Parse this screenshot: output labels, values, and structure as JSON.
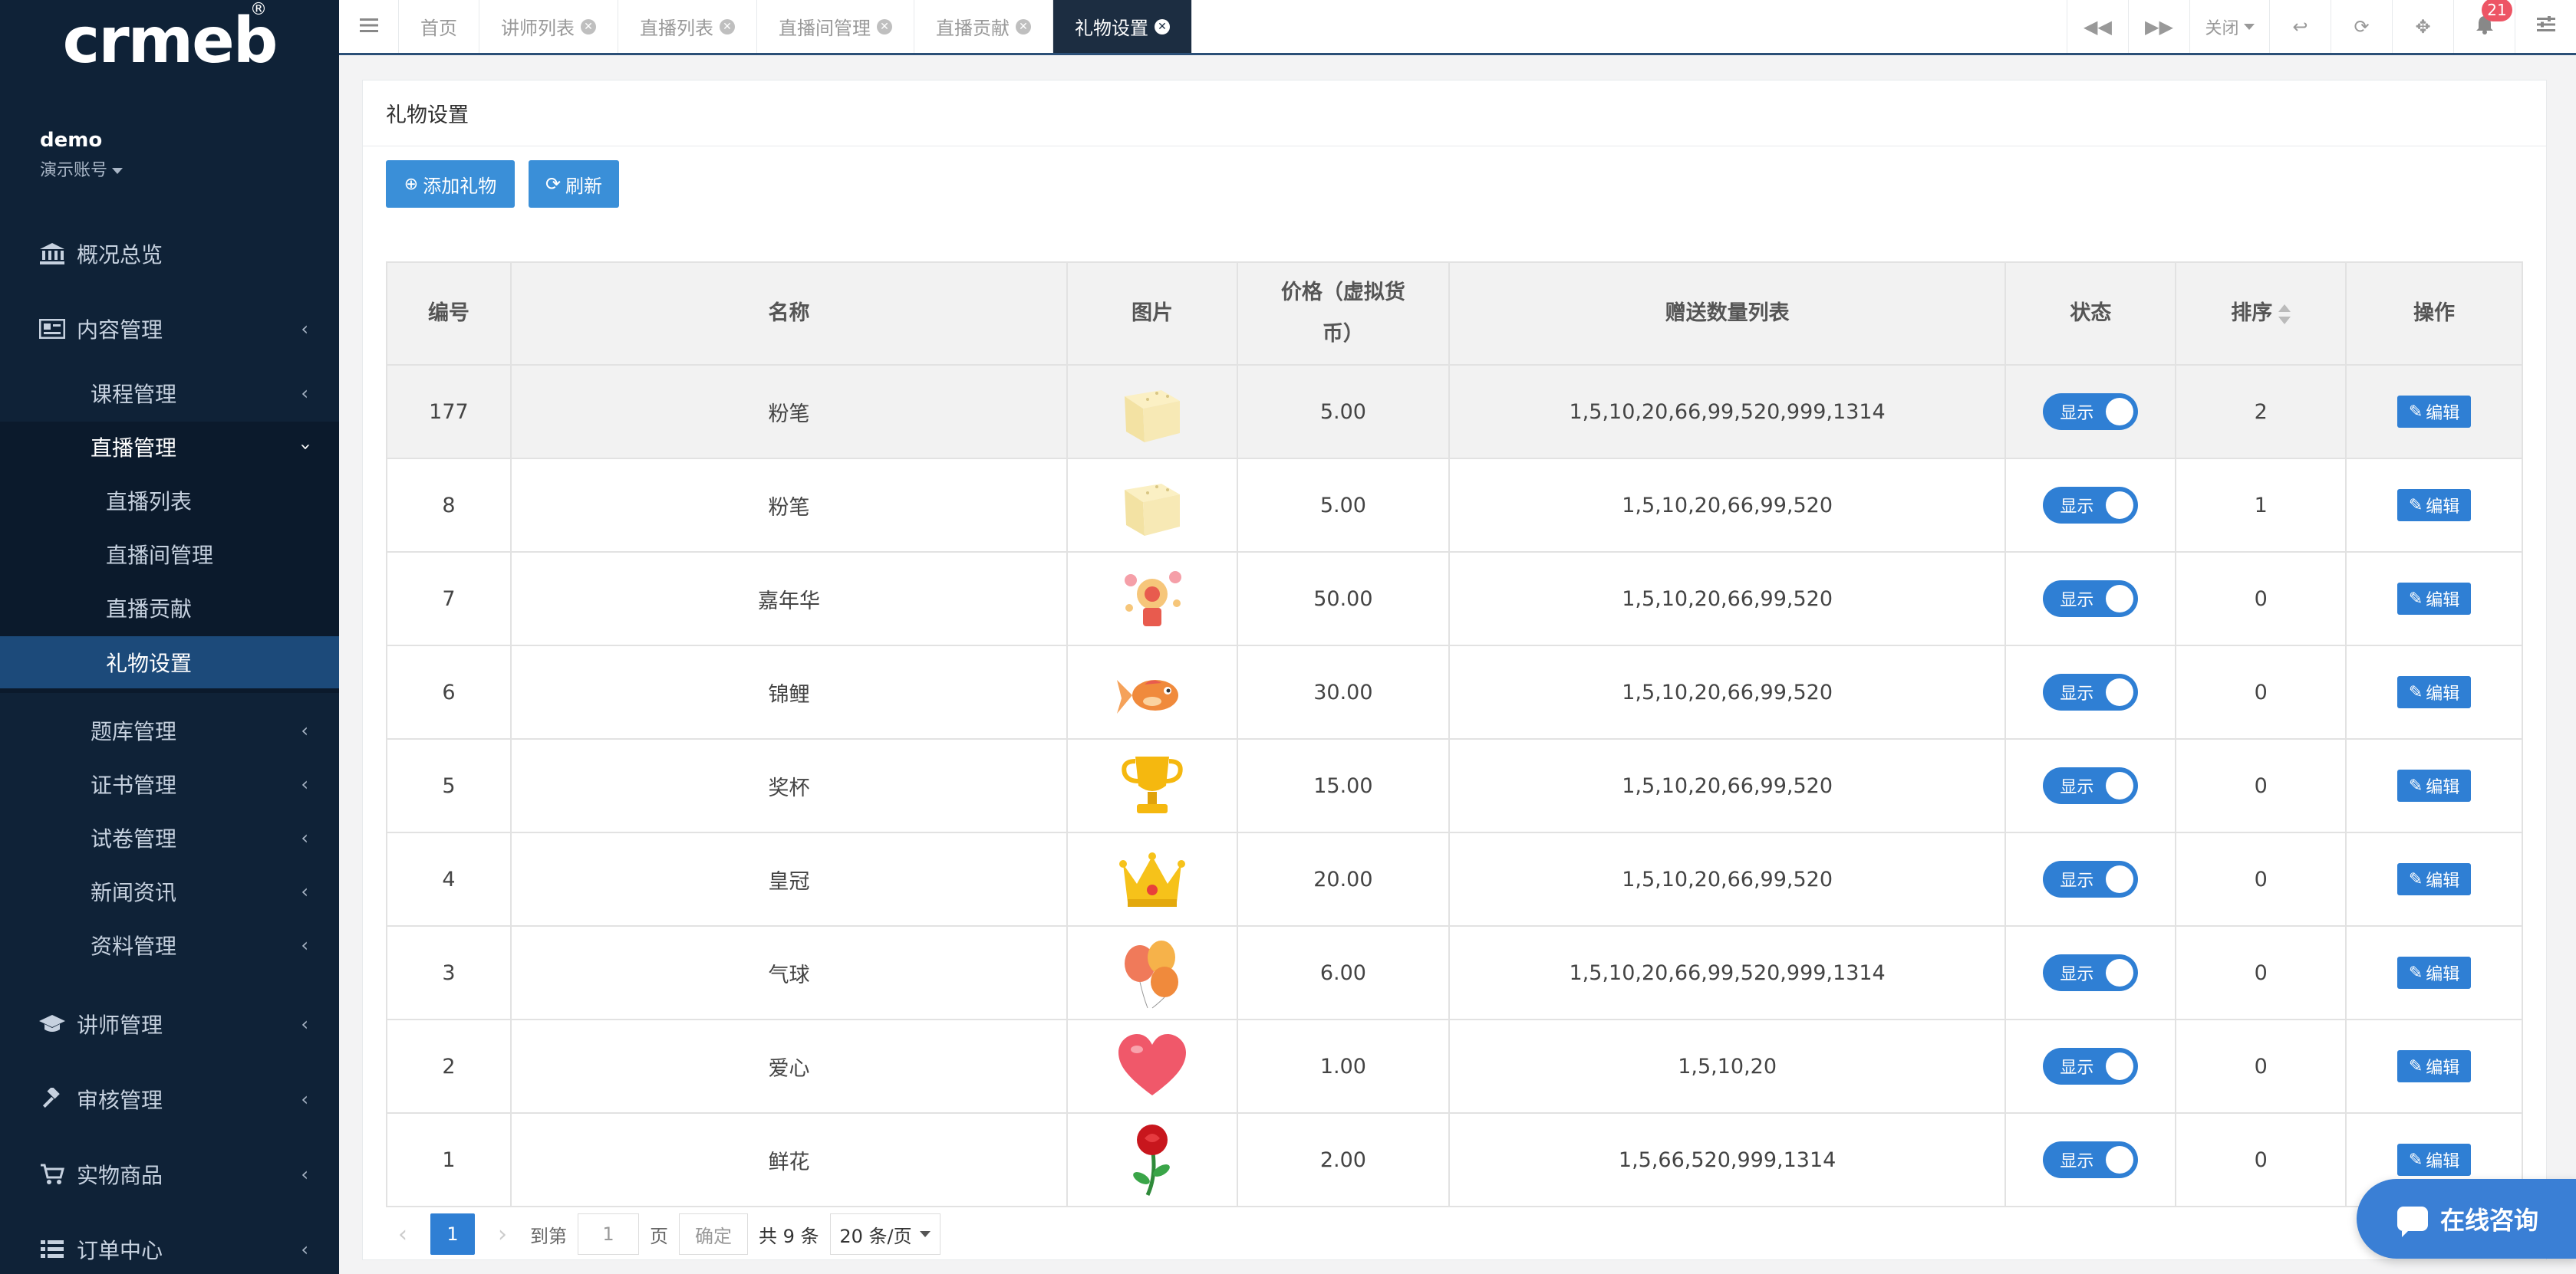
{
  "logo": {
    "text": "crmeb",
    "reg": "®"
  },
  "user": {
    "name": "demo",
    "role": "演示账号"
  },
  "sidebar": {
    "items": [
      {
        "label": "概况总览"
      },
      {
        "label": "内容管理"
      },
      {
        "label": "课程管理"
      },
      {
        "label": "直播管理"
      },
      {
        "label": "直播列表"
      },
      {
        "label": "直播间管理"
      },
      {
        "label": "直播贡献"
      },
      {
        "label": "礼物设置"
      },
      {
        "label": "题库管理"
      },
      {
        "label": "证书管理"
      },
      {
        "label": "试卷管理"
      },
      {
        "label": "新闻资讯"
      },
      {
        "label": "资料管理"
      },
      {
        "label": "讲师管理"
      },
      {
        "label": "审核管理"
      },
      {
        "label": "实物商品"
      },
      {
        "label": "订单中心"
      }
    ]
  },
  "tabs": [
    {
      "label": "首页"
    },
    {
      "label": "讲师列表"
    },
    {
      "label": "直播列表"
    },
    {
      "label": "直播间管理"
    },
    {
      "label": "直播贡献"
    },
    {
      "label": "礼物设置"
    }
  ],
  "toolbar": {
    "close_label": "关闭",
    "notifications": "21"
  },
  "panel": {
    "title": "礼物设置",
    "add_label": "添加礼物",
    "refresh_label": "刷新"
  },
  "table": {
    "headers": [
      "编号",
      "名称",
      "图片",
      "价格（虚拟货币）",
      "赠送数量列表",
      "状态",
      "排序",
      "操作"
    ],
    "status_label": "显示",
    "edit_label": "编辑",
    "rows": [
      {
        "id": "177",
        "name": "粉笔",
        "icon": "chalk",
        "price": "5.00",
        "amounts": "1,5,10,20,66,99,520,999,1314",
        "sort": "2"
      },
      {
        "id": "8",
        "name": "粉笔",
        "icon": "chalk",
        "price": "5.00",
        "amounts": "1,5,10,20,66,99,520",
        "sort": "1"
      },
      {
        "id": "7",
        "name": "嘉年华",
        "icon": "carnival",
        "price": "50.00",
        "amounts": "1,5,10,20,66,99,520",
        "sort": "0"
      },
      {
        "id": "6",
        "name": "锦鲤",
        "icon": "koi",
        "price": "30.00",
        "amounts": "1,5,10,20,66,99,520",
        "sort": "0"
      },
      {
        "id": "5",
        "name": "奖杯",
        "icon": "trophy",
        "price": "15.00",
        "amounts": "1,5,10,20,66,99,520",
        "sort": "0"
      },
      {
        "id": "4",
        "name": "皇冠",
        "icon": "crown",
        "price": "20.00",
        "amounts": "1,5,10,20,66,99,520",
        "sort": "0"
      },
      {
        "id": "3",
        "name": "气球",
        "icon": "balloon",
        "price": "6.00",
        "amounts": "1,5,10,20,66,99,520,999,1314",
        "sort": "0"
      },
      {
        "id": "2",
        "name": "爱心",
        "icon": "heart",
        "price": "1.00",
        "amounts": "1,5,10,20",
        "sort": "0"
      },
      {
        "id": "1",
        "name": "鲜花",
        "icon": "rose",
        "price": "2.00",
        "amounts": "1,5,66,520,999,1314",
        "sort": "0"
      }
    ]
  },
  "pager": {
    "current": "1",
    "goto_label": "到第",
    "page_input": "1",
    "page_unit": "页",
    "confirm_label": "确定",
    "total_label": "共 9 条",
    "page_size": "20 条/页"
  },
  "chat": {
    "label": "在线咨询"
  }
}
